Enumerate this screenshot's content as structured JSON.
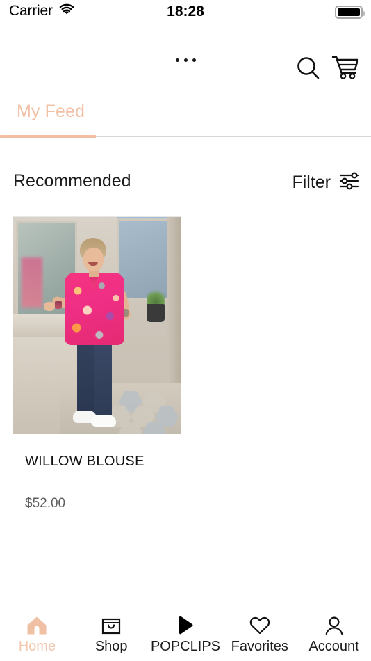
{
  "status_bar": {
    "carrier": "Carrier",
    "wifi_icon": "wifi-icon",
    "time": "18:28",
    "battery_icon": "battery-full-icon"
  },
  "top_bar": {
    "more_icon": "ellipsis-icon",
    "search_icon": "search-icon",
    "cart_icon": "shopping-cart-icon"
  },
  "tabs": {
    "items": [
      {
        "label": "My Feed",
        "active": true
      }
    ],
    "active_color": "#f2bda0"
  },
  "section": {
    "title": "Recommended",
    "filter_label": "Filter",
    "filter_icon": "sliders-icon"
  },
  "products": [
    {
      "name": "WILLOW BLOUSE",
      "price": "$52.00",
      "image_alt": "woman-in-pink-floral-blouse"
    }
  ],
  "bottom_nav": {
    "items": [
      {
        "label": "Home",
        "icon": "home-icon",
        "active": true
      },
      {
        "label": "Shop",
        "icon": "shopping-bag-icon",
        "active": false
      },
      {
        "label": "POPCLIPS",
        "icon": "play-icon",
        "active": false
      },
      {
        "label": "Favorites",
        "icon": "heart-icon",
        "active": false
      },
      {
        "label": "Account",
        "icon": "person-icon",
        "active": false
      }
    ],
    "active_color": "#f3c6ad"
  }
}
